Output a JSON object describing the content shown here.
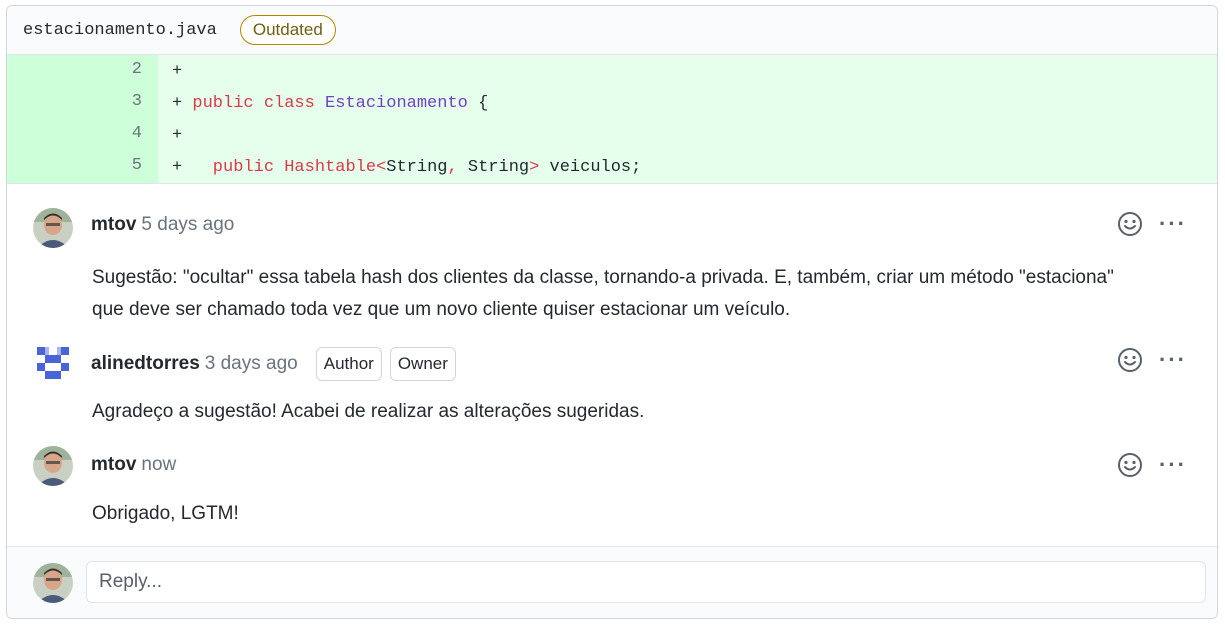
{
  "file": {
    "name": "estacionamento.java",
    "status_label": "Outdated"
  },
  "diff": {
    "lines": [
      {
        "number": "2",
        "prefix": "+",
        "tokens": []
      },
      {
        "number": "3",
        "prefix": "+",
        "tokens": [
          {
            "text": " public",
            "kind": "kw"
          },
          {
            "text": " class",
            "kind": "kw"
          },
          {
            "text": " Estacionamento",
            "kind": "ty"
          },
          {
            "text": " {",
            "kind": "pl"
          }
        ]
      },
      {
        "number": "4",
        "prefix": "+",
        "tokens": []
      },
      {
        "number": "5",
        "prefix": "+",
        "tokens": [
          {
            "text": "   public",
            "kind": "kw"
          },
          {
            "text": " Hashtable",
            "kind": "kw"
          },
          {
            "text": "<",
            "kind": "kw"
          },
          {
            "text": "String",
            "kind": "pl"
          },
          {
            "text": ",",
            "kind": "kw"
          },
          {
            "text": " String",
            "kind": "pl"
          },
          {
            "text": ">",
            "kind": "kw"
          },
          {
            "text": " veiculos;",
            "kind": "pl"
          }
        ]
      }
    ]
  },
  "comments": [
    {
      "author": "mtov",
      "time": "5 days ago",
      "badges": [],
      "body_lines": [
        "Sugestão: \"ocultar\" essa tabela hash dos clientes da classe, tornando-a privada. E, também, criar um método \"estaciona\"",
        "que deve ser chamado toda vez que um novo cliente quiser estacionar um veículo."
      ]
    },
    {
      "author": "alinedtorres",
      "time": "3 days ago",
      "badges": [
        "Author",
        "Owner"
      ],
      "body_lines": [
        "Agradeço a sugestão! Acabei de realizar as alterações sugeridas."
      ]
    },
    {
      "author": "mtov",
      "time": "now",
      "badges": [],
      "body_lines": [
        "Obrigado, LGTM!"
      ]
    }
  ],
  "reply": {
    "placeholder": "Reply..."
  },
  "icons": {
    "reaction": "smiley-icon",
    "more": "kebab-horizontal-icon"
  },
  "colors": {
    "addition_bg": "#e6ffed",
    "addition_gutter": "#cdffd8",
    "keyword": "#d73a49",
    "type": "#6f42c1",
    "outdated_border": "#b08800"
  }
}
